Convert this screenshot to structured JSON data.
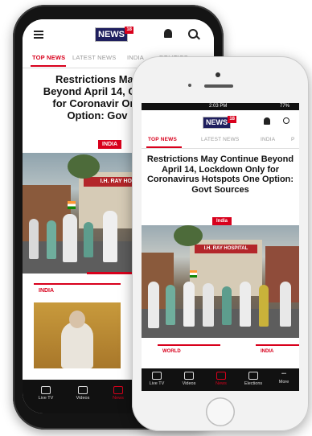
{
  "back_phone": {
    "logo_text": "NEWS",
    "logo_number": "18",
    "tabs": [
      "TOP NEWS",
      "LATEST NEWS",
      "INDIA",
      "POLITICS"
    ],
    "headline": "Restrictions May Beyond April 14, Only for Coronavir One Option: Gov",
    "badge": "INDIA",
    "hospital_sign": "I.H. RAY HOSP",
    "card_label": "INDIA",
    "nav": [
      "Live TV",
      "Videos",
      "News"
    ]
  },
  "front_phone": {
    "status_time": "2:03 PM",
    "status_battery": "77%",
    "logo_text": "NEWS",
    "logo_number": "18",
    "tabs": [
      "TOP NEWS",
      "LATEST NEWS",
      "INDIA",
      "P"
    ],
    "headline": "Restrictions May Continue Beyond April 14, Lockdown Only for Coronavirus Hotspots One Option: Govt Sources",
    "badge": "India",
    "hospital_sign": "I.H. RAY HOSPITAL",
    "cards": [
      "WORLD",
      "INDIA"
    ],
    "nav": [
      "Live TV",
      "Videos",
      "News",
      "Elections",
      "More"
    ]
  },
  "colors": {
    "accent": "#d8001c",
    "logo_bg": "#1f1f5e"
  }
}
